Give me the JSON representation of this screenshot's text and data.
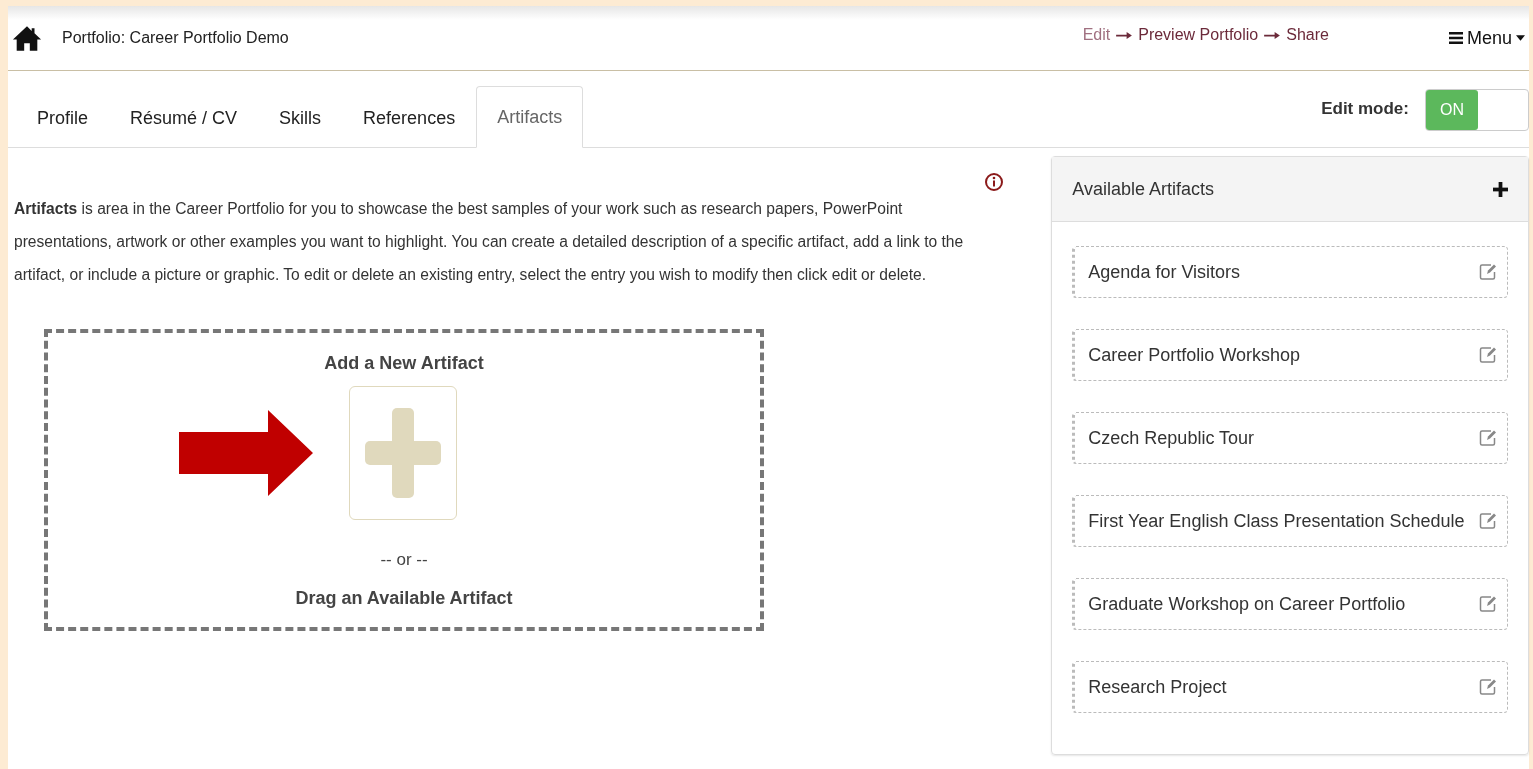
{
  "header": {
    "title": "Portfolio: Career Portfolio Demo",
    "steps": [
      {
        "label": "Edit",
        "selected": true
      },
      {
        "label": "Preview Portfolio",
        "selected": false
      },
      {
        "label": "Share",
        "selected": false
      }
    ],
    "menu": "Menu"
  },
  "tabs": [
    {
      "label": "Profile",
      "selected": false
    },
    {
      "label": "Résumé / CV",
      "selected": false
    },
    {
      "label": "Skills",
      "selected": false
    },
    {
      "label": "References",
      "selected": false
    },
    {
      "label": "Artifacts",
      "selected": true
    }
  ],
  "edit_mode": {
    "label": "Edit mode:",
    "on": true,
    "state_label": "ON"
  },
  "intro": "**Artifacts** is area in the Career Portfolio for you to showcase the best samples of your work such as research papers, PowerPoint presentations, artwork or other examples you want to highlight. You can create a detailed description of a specific artifact, add a link to the artifact, or include a picture or graphic. To edit or delete an existing entry, select the entry you wish to modify then click edit or delete.",
  "drop_zone": {
    "title": "Add a New Artifact",
    "separator": "-- or --",
    "hint": "Drag an Available Artifact"
  },
  "available": {
    "title": "Available Artifacts",
    "items": [
      "Agenda for Visitors",
      "Career Portfolio Workshop",
      "Czech Republic Tour",
      "First Year English Class Presentation Schedule",
      "Graduate Workshop on Career Portfolio",
      "Research Project"
    ]
  }
}
